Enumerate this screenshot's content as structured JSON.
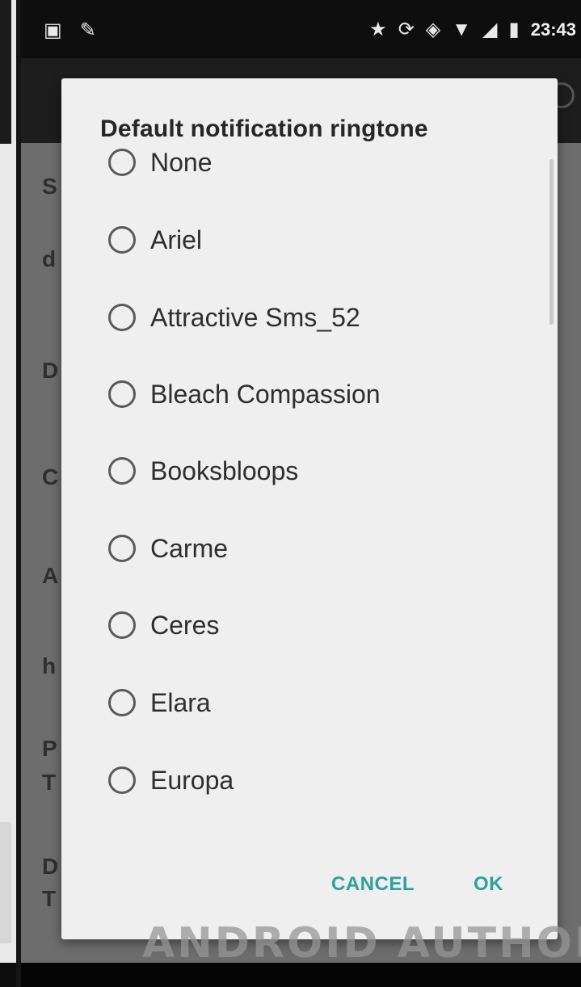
{
  "status_bar": {
    "left_icons": [
      "image-icon",
      "brush-icon"
    ],
    "right_icons": [
      "star-icon",
      "sync-icon",
      "shield-icon",
      "wifi-icon",
      "signal-icon",
      "battery-icon"
    ],
    "time": "23:43"
  },
  "background": {
    "list_initials": [
      "S",
      "d",
      "D",
      "C",
      "A",
      "h",
      "P",
      "T",
      "D",
      "T"
    ]
  },
  "dialog": {
    "title": "Default notification ringtone",
    "options": [
      {
        "label": "None",
        "selected": false
      },
      {
        "label": "Ariel",
        "selected": false
      },
      {
        "label": "Attractive Sms_52",
        "selected": false
      },
      {
        "label": "Bleach Compassion",
        "selected": false
      },
      {
        "label": "Booksbloops",
        "selected": false
      },
      {
        "label": "Carme",
        "selected": false
      },
      {
        "label": "Ceres",
        "selected": false
      },
      {
        "label": "Elara",
        "selected": false
      },
      {
        "label": "Europa",
        "selected": false
      }
    ],
    "cancel_label": "CANCEL",
    "ok_label": "OK"
  },
  "watermark": "ANDROID AUTHORITY",
  "colors": {
    "accent": "#2aa39a",
    "dialog_bg": "#efefef",
    "scrim": "#6b6b6b"
  }
}
